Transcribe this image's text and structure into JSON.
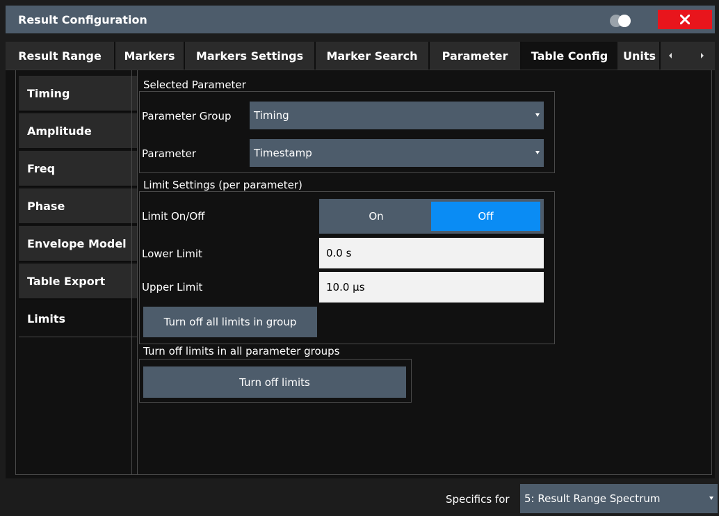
{
  "window": {
    "title": "Result Configuration"
  },
  "tabs": [
    {
      "label": "Result Range"
    },
    {
      "label": "Markers"
    },
    {
      "label": "Markers Settings"
    },
    {
      "label": "Marker Search"
    },
    {
      "label": "Parameter"
    },
    {
      "label": "Table Config"
    },
    {
      "label": "Units"
    }
  ],
  "active_tab": "Table Config",
  "side_tabs": [
    {
      "label": "Timing"
    },
    {
      "label": "Amplitude"
    },
    {
      "label": "Freq"
    },
    {
      "label": "Phase"
    },
    {
      "label": "Envelope Model"
    },
    {
      "label": "Table Export"
    },
    {
      "label": "Limits"
    }
  ],
  "active_side_tab": "Limits",
  "selected_parameter": {
    "title": "Selected Parameter",
    "group_label": "Parameter Group",
    "group_value": "Timing",
    "param_label": "Parameter",
    "param_value": "Timestamp"
  },
  "limit_settings": {
    "title": "Limit Settings (per parameter)",
    "onoff_label": "Limit On/Off",
    "on_label": "On",
    "off_label": "Off",
    "selected": "Off",
    "lower_label": "Lower Limit",
    "lower_value": "0.0 s",
    "upper_label": "Upper Limit",
    "upper_value": "10.0 µs",
    "turn_off_group_button": "Turn off all limits in group"
  },
  "all_groups": {
    "title": "Turn off limits in all parameter groups",
    "button": "Turn off limits"
  },
  "footer": {
    "specifics_label": "Specifics for",
    "specifics_value": "5: Result Range Spectrum"
  },
  "colors": {
    "accent": "#0a8cf4",
    "control_bg": "#4d5c6b",
    "close": "#e8151c"
  }
}
